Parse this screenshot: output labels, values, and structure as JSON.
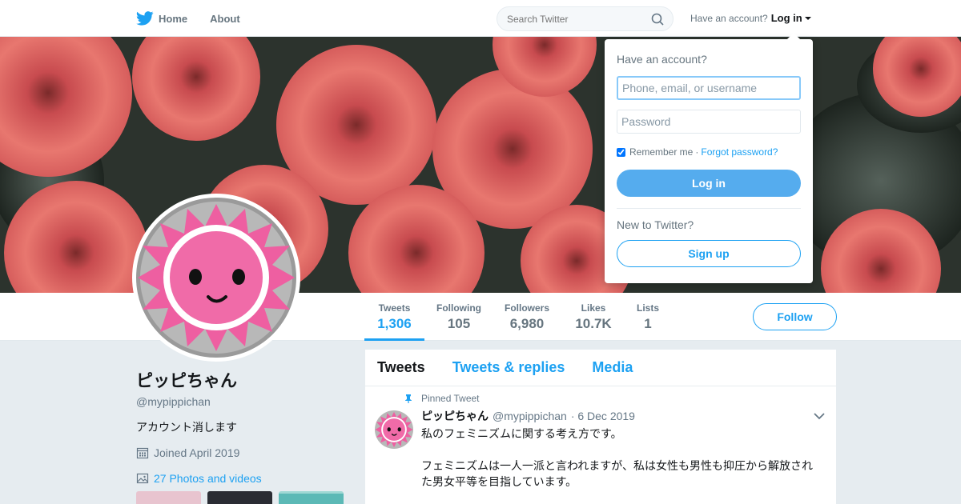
{
  "nav": {
    "home_label": "Home",
    "about_label": "About",
    "search_placeholder": "Search Twitter",
    "have_account_label": "Have an account?",
    "login_label": "Log in"
  },
  "profile": {
    "name": "ピッピちゃん",
    "handle": "@mypippichan",
    "bio": "アカウント消します",
    "joined": "Joined April 2019",
    "photos_link": "27 Photos and videos",
    "stats": [
      {
        "label": "Tweets",
        "value": "1,306"
      },
      {
        "label": "Following",
        "value": "105"
      },
      {
        "label": "Followers",
        "value": "6,980"
      },
      {
        "label": "Likes",
        "value": "10.7K"
      },
      {
        "label": "Lists",
        "value": "1"
      }
    ],
    "follow_label": "Follow"
  },
  "timeline": {
    "tabs": [
      "Tweets",
      "Tweets & replies",
      "Media"
    ],
    "pinned_label": "Pinned Tweet",
    "tweet": {
      "name": "ピッピちゃん",
      "handle": "@mypippichan",
      "date": "· 6 Dec 2019",
      "line1": "私のフェミニズムに関する考え方です。",
      "line2": "フェミニズムは一人一派と言われますが、私は女性も男性も抑圧から解放された男女平等を目指しています。"
    }
  },
  "login_dropdown": {
    "title": "Have an account?",
    "username_placeholder": "Phone, email, or username",
    "password_placeholder": "Password",
    "remember_label": "Remember me",
    "separator": "·",
    "forgot_label": "Forgot password?",
    "login_button": "Log in",
    "new_label": "New to Twitter?",
    "signup_button": "Sign up"
  },
  "colors": {
    "accent": "#1da1f2",
    "login_button": "#55acee",
    "avatar_pink": "#f06ba8"
  },
  "icons": [
    "twitter-bird-icon",
    "search-icon",
    "calendar-icon",
    "photo-icon",
    "pin-icon",
    "chevron-down-icon"
  ]
}
